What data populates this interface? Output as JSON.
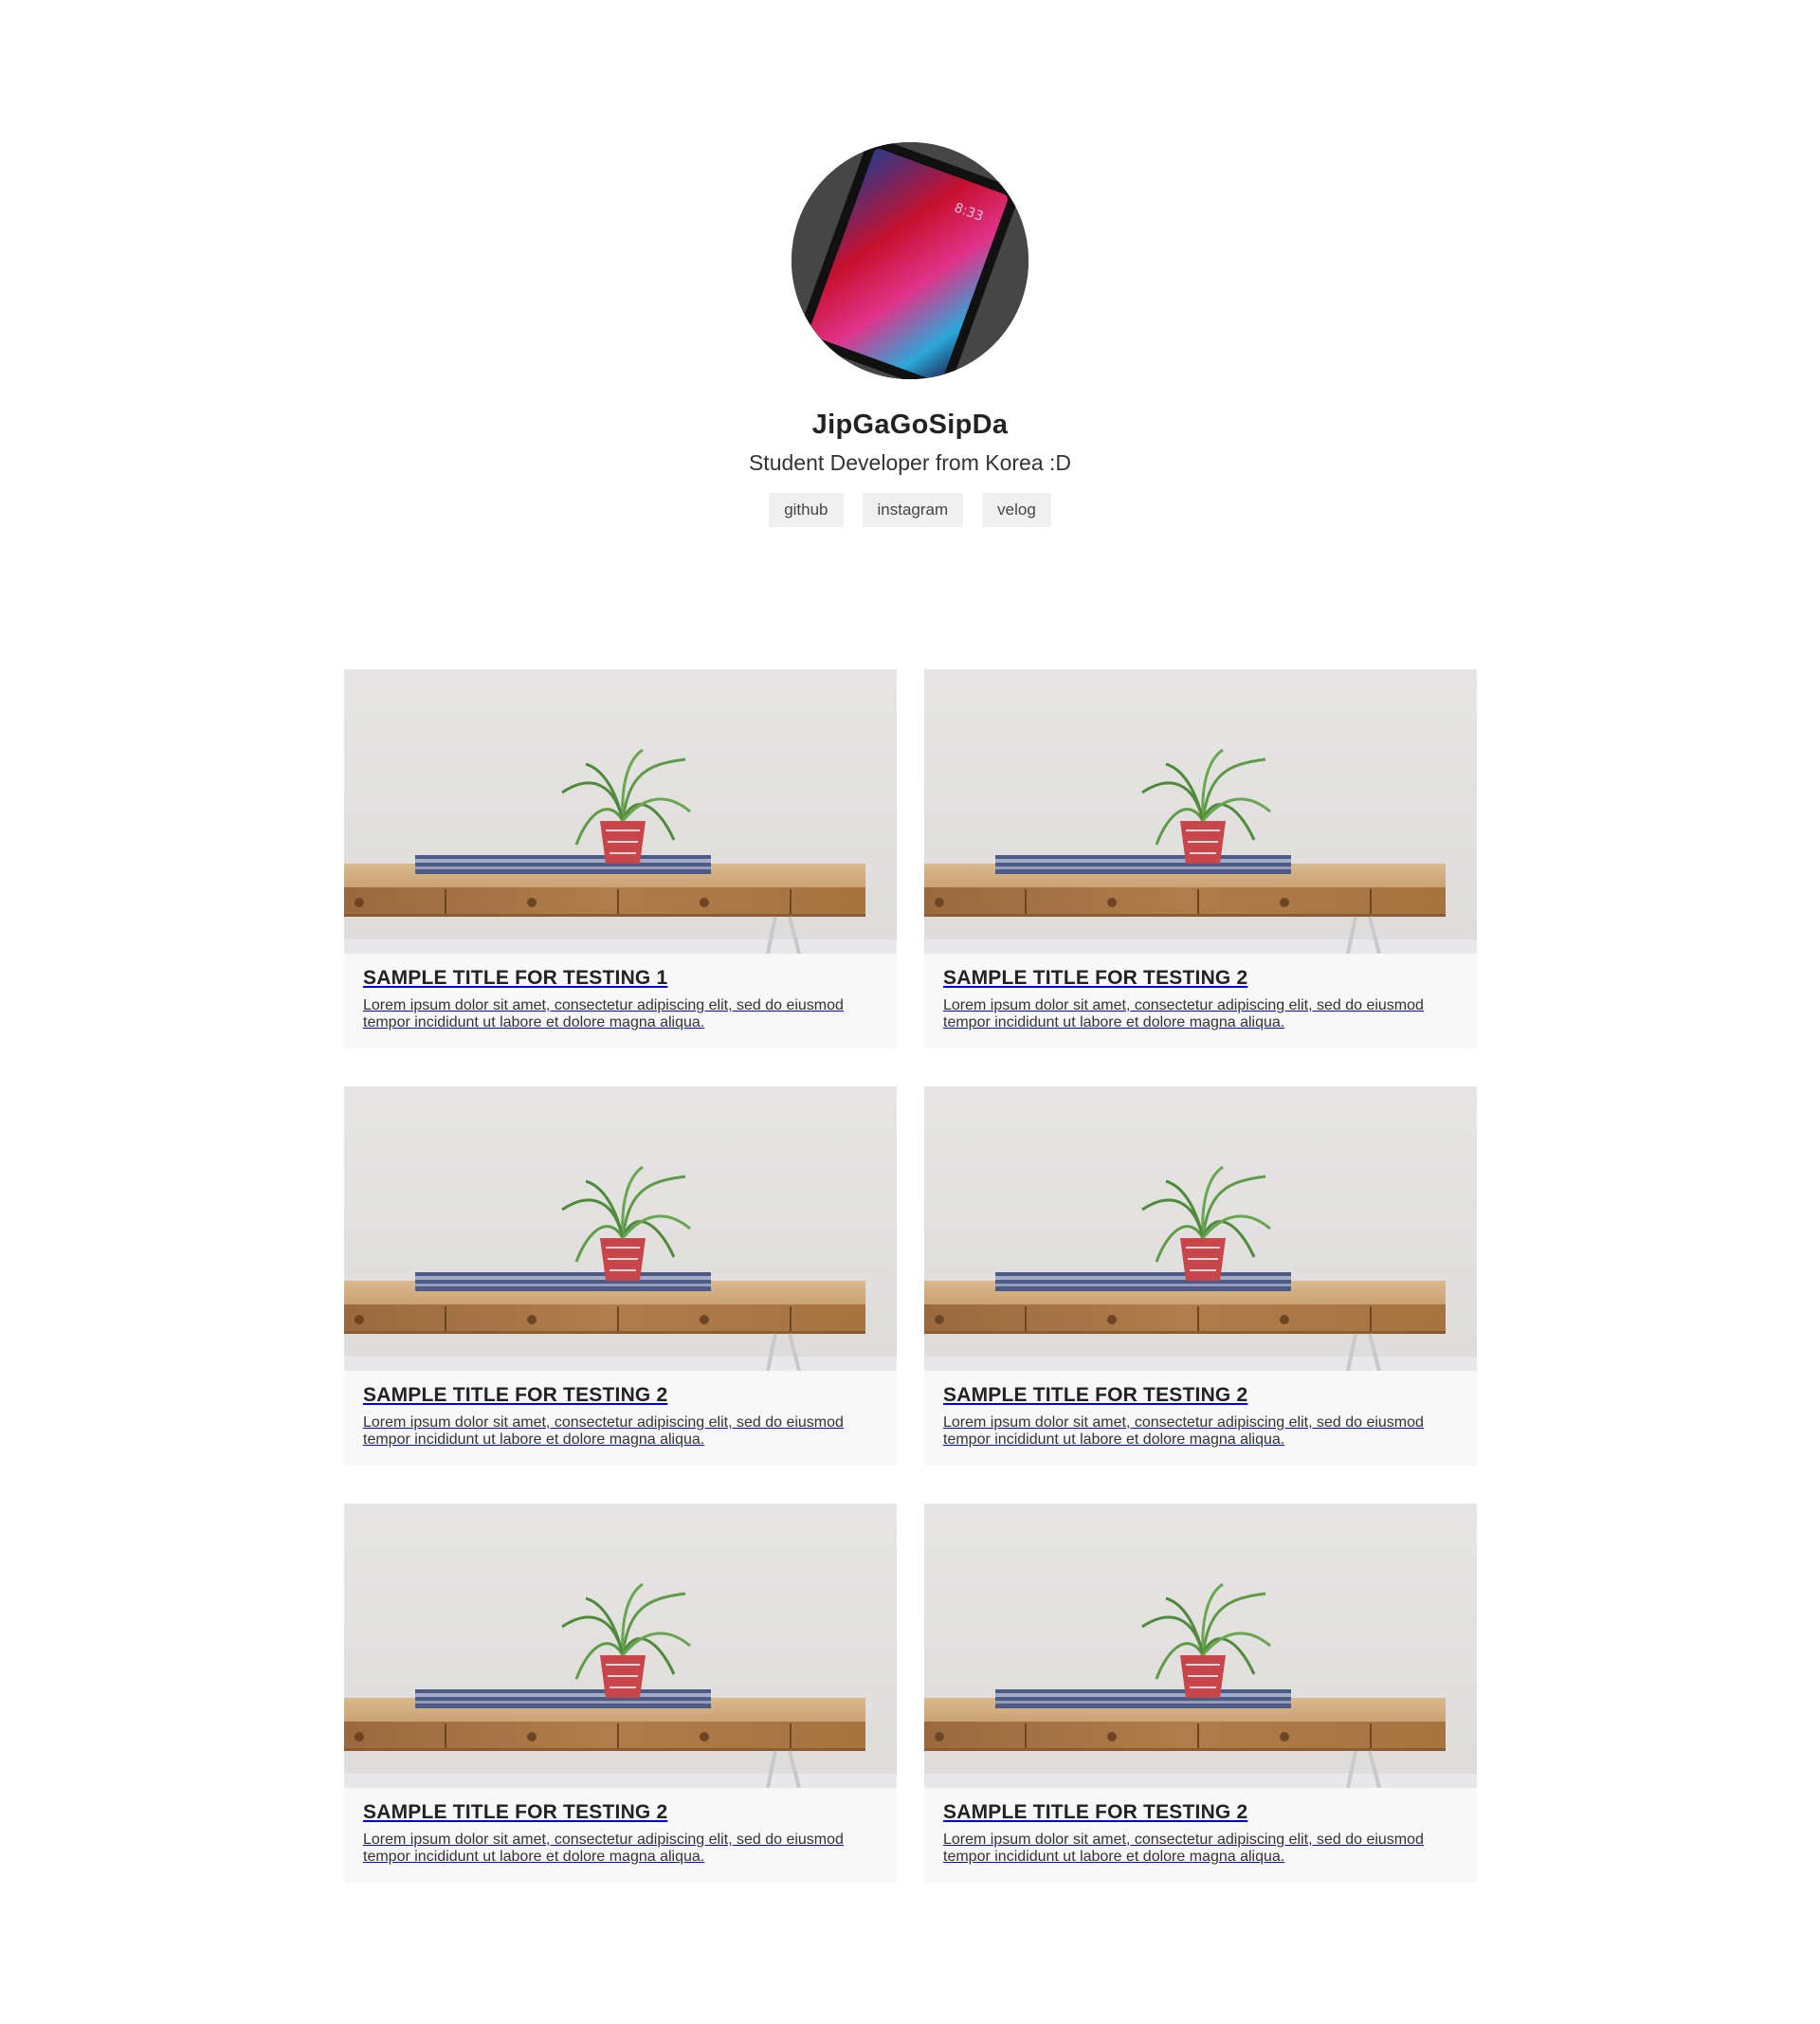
{
  "profile": {
    "name": "JipGaGoSipDa",
    "bio": "Student Developer from Korea :D",
    "links": [
      {
        "label": "github"
      },
      {
        "label": "instagram"
      },
      {
        "label": "velog"
      }
    ]
  },
  "posts": [
    {
      "title": "SAMPLE TITLE FOR TESTING 1",
      "text": "Lorem ipsum dolor sit amet, consectetur adipiscing elit, sed do eiusmod tempor incididunt ut labore et dolore magna aliqua."
    },
    {
      "title": "SAMPLE TITLE FOR TESTING 2",
      "text": "Lorem ipsum dolor sit amet, consectetur adipiscing elit, sed do eiusmod tempor incididunt ut labore et dolore magna aliqua."
    },
    {
      "title": "SAMPLE TITLE FOR TESTING 2",
      "text": "Lorem ipsum dolor sit amet, consectetur adipiscing elit, sed do eiusmod tempor incididunt ut labore et dolore magna aliqua."
    },
    {
      "title": "SAMPLE TITLE FOR TESTING 2",
      "text": "Lorem ipsum dolor sit amet, consectetur adipiscing elit, sed do eiusmod tempor incididunt ut labore et dolore magna aliqua."
    },
    {
      "title": "SAMPLE TITLE FOR TESTING 2",
      "text": "Lorem ipsum dolor sit amet, consectetur adipiscing elit, sed do eiusmod tempor incididunt ut labore et dolore magna aliqua."
    },
    {
      "title": "SAMPLE TITLE FOR TESTING 2",
      "text": "Lorem ipsum dolor sit amet, consectetur adipiscing elit, sed do eiusmod tempor incididunt ut labore et dolore magna aliqua."
    }
  ],
  "colors": {
    "background": "#ffffff",
    "card_background": "#f8f8f8",
    "chip_background": "#f0f0f0",
    "text": "#222222"
  }
}
